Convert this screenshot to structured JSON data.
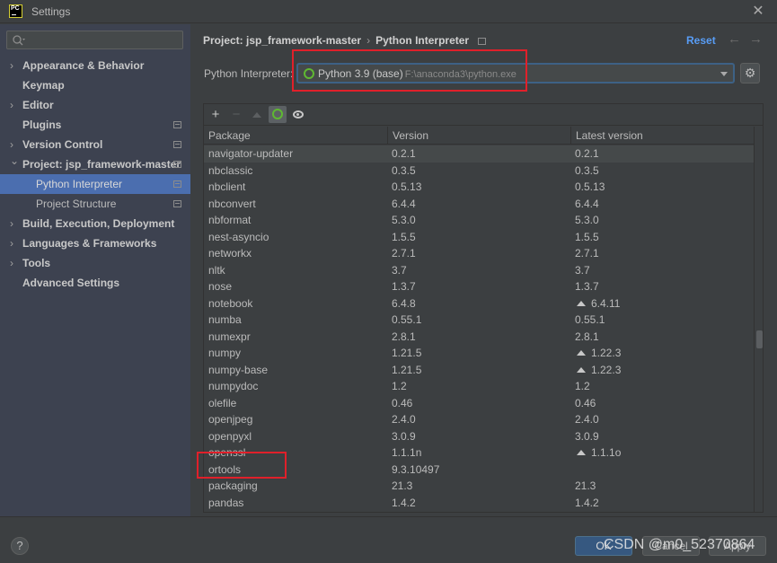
{
  "window": {
    "title": "Settings",
    "app_logo_text": "PC"
  },
  "sidebar": {
    "search_placeholder": "",
    "items": [
      {
        "label": "Appearance & Behavior",
        "expandable": true,
        "expanded": false
      },
      {
        "label": "Keymap",
        "expandable": false
      },
      {
        "label": "Editor",
        "expandable": true,
        "expanded": false
      },
      {
        "label": "Plugins",
        "expandable": false,
        "project_icon": true
      },
      {
        "label": "Version Control",
        "expandable": true,
        "expanded": false,
        "project_icon": true
      },
      {
        "label": "Project: jsp_framework-master",
        "expandable": true,
        "expanded": true,
        "project_icon": true
      },
      {
        "label": "Python Interpreter",
        "sub": true,
        "selected": true,
        "project_icon": true
      },
      {
        "label": "Project Structure",
        "sub": true,
        "project_icon": true
      },
      {
        "label": "Build, Execution, Deployment",
        "expandable": true,
        "expanded": false
      },
      {
        "label": "Languages & Frameworks",
        "expandable": true,
        "expanded": false
      },
      {
        "label": "Tools",
        "expandable": true,
        "expanded": false
      },
      {
        "label": "Advanced Settings",
        "expandable": false
      }
    ]
  },
  "header": {
    "breadcrumb": [
      "Project: jsp_framework-master",
      "Python Interpreter"
    ],
    "separator": "›",
    "reset_label": "Reset",
    "back_icon": "←",
    "forward_icon": "→"
  },
  "interpreter": {
    "label": "Python Interpreter:",
    "selected_name": "Python 3.9 (base)",
    "selected_path": "F:\\anaconda3\\python.exe",
    "settings_icon": "⚙"
  },
  "toolbar": {
    "add_icon": "+",
    "remove_icon": "−"
  },
  "packages": {
    "columns": [
      "Package",
      "Version",
      "Latest version"
    ],
    "rows": [
      {
        "name": "navigator-updater",
        "version": "0.2.1",
        "latest": "0.2.1",
        "upgrade": false
      },
      {
        "name": "nbclassic",
        "version": "0.3.5",
        "latest": "0.3.5",
        "upgrade": false
      },
      {
        "name": "nbclient",
        "version": "0.5.13",
        "latest": "0.5.13",
        "upgrade": false
      },
      {
        "name": "nbconvert",
        "version": "6.4.4",
        "latest": "6.4.4",
        "upgrade": false
      },
      {
        "name": "nbformat",
        "version": "5.3.0",
        "latest": "5.3.0",
        "upgrade": false
      },
      {
        "name": "nest-asyncio",
        "version": "1.5.5",
        "latest": "1.5.5",
        "upgrade": false
      },
      {
        "name": "networkx",
        "version": "2.7.1",
        "latest": "2.7.1",
        "upgrade": false
      },
      {
        "name": "nltk",
        "version": "3.7",
        "latest": "3.7",
        "upgrade": false
      },
      {
        "name": "nose",
        "version": "1.3.7",
        "latest": "1.3.7",
        "upgrade": false
      },
      {
        "name": "notebook",
        "version": "6.4.8",
        "latest": "6.4.11",
        "upgrade": true
      },
      {
        "name": "numba",
        "version": "0.55.1",
        "latest": "0.55.1",
        "upgrade": false
      },
      {
        "name": "numexpr",
        "version": "2.8.1",
        "latest": "2.8.1",
        "upgrade": false
      },
      {
        "name": "numpy",
        "version": "1.21.5",
        "latest": "1.22.3",
        "upgrade": true
      },
      {
        "name": "numpy-base",
        "version": "1.21.5",
        "latest": "1.22.3",
        "upgrade": true
      },
      {
        "name": "numpydoc",
        "version": "1.2",
        "latest": "1.2",
        "upgrade": false
      },
      {
        "name": "olefile",
        "version": "0.46",
        "latest": "0.46",
        "upgrade": false
      },
      {
        "name": "openjpeg",
        "version": "2.4.0",
        "latest": "2.4.0",
        "upgrade": false
      },
      {
        "name": "openpyxl",
        "version": "3.0.9",
        "latest": "3.0.9",
        "upgrade": false
      },
      {
        "name": "openssl",
        "version": "1.1.1n",
        "latest": "1.1.1o",
        "upgrade": true
      },
      {
        "name": "ortools",
        "version": "9.3.10497",
        "latest": "",
        "upgrade": false
      },
      {
        "name": "packaging",
        "version": "21.3",
        "latest": "21.3",
        "upgrade": false
      },
      {
        "name": "pandas",
        "version": "1.4.2",
        "latest": "1.4.2",
        "upgrade": false
      }
    ]
  },
  "footer": {
    "help_label": "?",
    "ok_label": "OK",
    "cancel_label": "Cancel",
    "apply_label": "Apply",
    "watermark": "CSDN @m0_52370864"
  },
  "colors": {
    "accent": "#4b6eaf",
    "link": "#589df6",
    "annotation_red": "#e0202a",
    "spinner_green": "#5fb832"
  }
}
